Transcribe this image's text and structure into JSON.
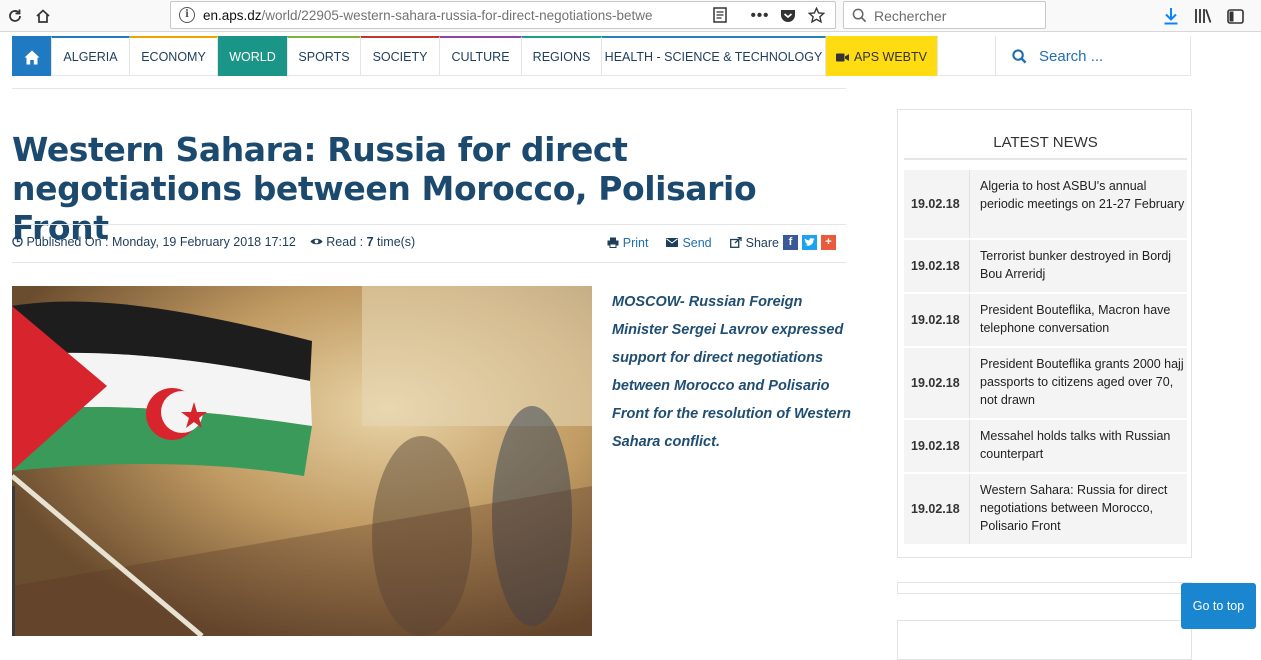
{
  "browser": {
    "url_host": "en.aps.dz",
    "url_path": "/world/22905-western-sahara-russia-for-direct-negotiations-betwe",
    "search_placeholder": "Rechercher"
  },
  "nav": {
    "items": [
      {
        "label": "ALGERIA"
      },
      {
        "label": "ECONOMY"
      },
      {
        "label": "WORLD"
      },
      {
        "label": "SPORTS"
      },
      {
        "label": "SOCIETY"
      },
      {
        "label": "CULTURE"
      },
      {
        "label": "REGIONS"
      },
      {
        "label": "HEALTH - SCIENCE & TECHNOLOGY"
      },
      {
        "label": "APS WEBTV"
      }
    ],
    "search_placeholder": "Search ..."
  },
  "article": {
    "title": "Western Sahara: Russia for direct negotiations between Morocco, Polisario Front",
    "published_label": "Published On : Monday, 19 February 2018 17:12",
    "read_label": "Read :",
    "read_count": "7",
    "read_suffix": "time(s)",
    "print_label": "Print",
    "send_label": "Send",
    "share_label": "Share",
    "lead": "MOSCOW- Russian Foreign Minister Sergei Lavrov expressed support for direct negotiations between Morocco and Polisario Front for the resolution of Western Sahara conflict."
  },
  "sidebar": {
    "title": "LATEST NEWS",
    "items": [
      {
        "date": "19.02.18",
        "text": "Algeria to host ASBU's annual periodic meetings on 21-27 February"
      },
      {
        "date": "19.02.18",
        "text": "Terrorist bunker destroyed in Bordj Bou Arreridj"
      },
      {
        "date": "19.02.18",
        "text": "President Bouteflika, Macron have telephone conversation"
      },
      {
        "date": "19.02.18",
        "text": "President Bouteflika grants 2000 hajj passports to citizens aged over 70, not drawn"
      },
      {
        "date": "19.02.18",
        "text": "Messahel holds talks with Russian counterpart"
      },
      {
        "date": "19.02.18",
        "text": "Western Sahara: Russia for direct negotiations between Morocco, Polisario Front"
      }
    ]
  },
  "go_top_label": "Go to top",
  "colors": {
    "title": "#1c4a6e",
    "nav_home": "#1f7ac1",
    "nav_world": "#1b9587",
    "nav_webtv": "#ffdb12",
    "go_top": "#1a86d0"
  }
}
